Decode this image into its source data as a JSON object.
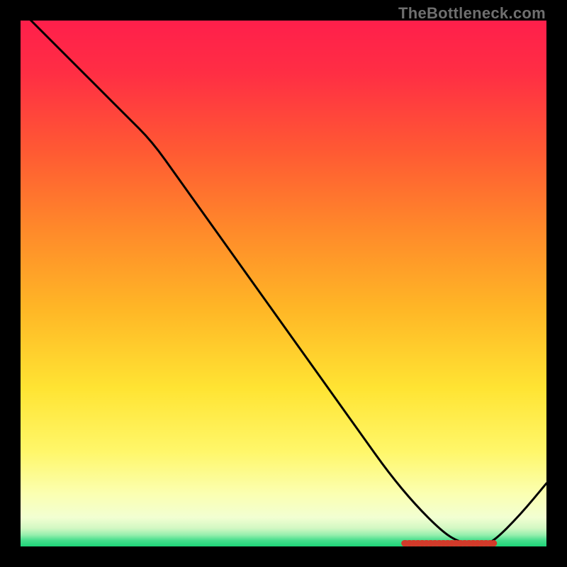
{
  "watermark": "TheBottleneck.com",
  "center_marker_label": "",
  "chart_data": {
    "type": "line",
    "title": "",
    "xlabel": "",
    "ylabel": "",
    "xlim": [
      0,
      100
    ],
    "ylim": [
      0,
      100
    ],
    "series": [
      {
        "name": "curve",
        "x": [
          0,
          5,
          10,
          15,
          20,
          25,
          30,
          35,
          40,
          45,
          50,
          55,
          60,
          65,
          70,
          75,
          80,
          83,
          86,
          88,
          90,
          95,
          100
        ],
        "y": [
          102,
          97,
          92,
          87,
          82,
          77,
          70,
          63,
          56,
          49,
          42,
          35,
          28,
          21,
          14,
          8,
          3,
          1,
          0.4,
          0.4,
          1,
          6,
          12
        ]
      }
    ],
    "gradient_stops": [
      {
        "offset": 0.0,
        "color": "#ff1f4b"
      },
      {
        "offset": 0.1,
        "color": "#ff2e44"
      },
      {
        "offset": 0.25,
        "color": "#ff5a33"
      },
      {
        "offset": 0.4,
        "color": "#ff8a2a"
      },
      {
        "offset": 0.55,
        "color": "#ffb726"
      },
      {
        "offset": 0.7,
        "color": "#ffe433"
      },
      {
        "offset": 0.82,
        "color": "#fff76a"
      },
      {
        "offset": 0.9,
        "color": "#fbffb1"
      },
      {
        "offset": 0.945,
        "color": "#f2ffd2"
      },
      {
        "offset": 0.965,
        "color": "#d3f8c3"
      },
      {
        "offset": 0.978,
        "color": "#97efae"
      },
      {
        "offset": 0.988,
        "color": "#49df8e"
      },
      {
        "offset": 1.0,
        "color": "#1ed477"
      }
    ],
    "marker": {
      "x_range": [
        73,
        90
      ],
      "y": 0.6,
      "color": "#d23a2a"
    }
  }
}
